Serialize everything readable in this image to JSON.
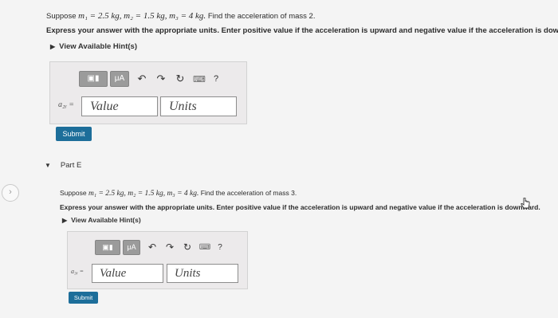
{
  "top": {
    "question": {
      "prefix": "Suppose",
      "m1": "m₁ = 2.5 kg,",
      "m2": "m₂ = 1.5 kg,",
      "m3": "m₃ = 4 kg.",
      "suffix": "Find the acceleration of mass 2."
    },
    "instructions": "Express your answer with the appropriate units. Enter positive value if the acceleration is upward and negative value if the acceleration is downward.",
    "hints_link": "View Available Hint(s)",
    "answer_label": "a₂ᵧ =",
    "value_placeholder": "Value",
    "units_placeholder": "Units",
    "submit_label": "Submit"
  },
  "part": {
    "title": "Part E",
    "question": {
      "prefix": "Suppose",
      "m1": "m₁ = 2.5 kg,",
      "m2": "m₂ = 1.5 kg,",
      "m3": "m₃ = 4 kg.",
      "suffix": "Find the acceleration of mass 3."
    },
    "instructions": "Express your answer with the appropriate units. Enter positive value if the acceleration is upward and negative value if the acceleration is downward.",
    "hints_link": "View Available Hint(s)",
    "answer_label": "a₃ᵧ =",
    "value_placeholder": "Value",
    "units_placeholder": "Units",
    "submit_label": "Submit"
  },
  "toolbar": {
    "micro_label": "μA",
    "help_label": "?"
  },
  "icons": {
    "templates": "templates-icon",
    "units": "units-icon",
    "undo": "undo-icon",
    "redo": "redo-icon",
    "reset": "reset-icon",
    "keyboard": "keyboard-icon",
    "help": "help-icon",
    "collapse": "triangle-down-icon",
    "side": "chevron-right-icon"
  }
}
